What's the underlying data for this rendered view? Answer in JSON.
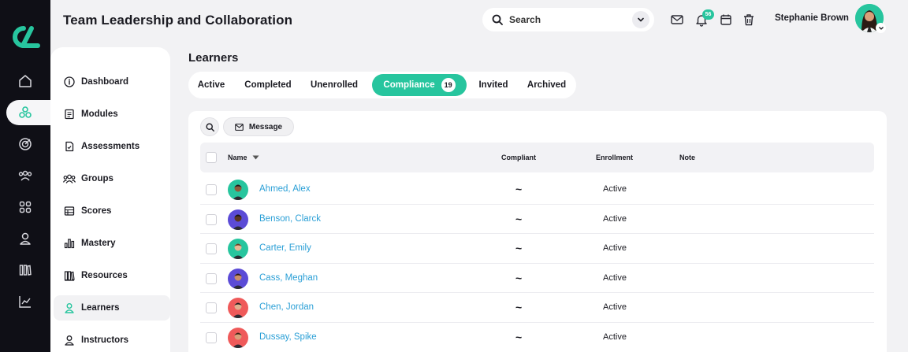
{
  "header": {
    "title": "Team Leadership and Collaboration",
    "search_placeholder": "Search",
    "notification_count": "56",
    "user_name": "Stephanie Brown"
  },
  "rail": {
    "items": [
      {
        "icon": "home-icon",
        "active": false
      },
      {
        "icon": "share-nodes-icon",
        "active": true
      },
      {
        "icon": "target-icon",
        "active": false
      },
      {
        "icon": "users-icon",
        "active": false
      },
      {
        "icon": "grid-icon",
        "active": false
      },
      {
        "icon": "user-icon",
        "active": false
      },
      {
        "icon": "library-icon",
        "active": false
      },
      {
        "icon": "chart-line-icon",
        "active": false
      }
    ]
  },
  "subnav": {
    "items": [
      {
        "label": "Dashboard",
        "icon": "info-icon"
      },
      {
        "label": "Modules",
        "icon": "document-icon"
      },
      {
        "label": "Assessments",
        "icon": "assessment-icon"
      },
      {
        "label": "Groups",
        "icon": "group-icon"
      },
      {
        "label": "Scores",
        "icon": "table-icon"
      },
      {
        "label": "Mastery",
        "icon": "bar-chart-icon"
      },
      {
        "label": "Resources",
        "icon": "books-icon"
      },
      {
        "label": "Learners",
        "icon": "learner-icon",
        "active": true
      },
      {
        "label": "Instructors",
        "icon": "instructor-icon"
      }
    ]
  },
  "main": {
    "section_title": "Learners",
    "tabs": [
      {
        "label": "Active"
      },
      {
        "label": "Completed"
      },
      {
        "label": "Unenrolled"
      },
      {
        "label": "Compliance",
        "count": "19",
        "active": true
      },
      {
        "label": "Invited"
      },
      {
        "label": "Archived"
      }
    ],
    "toolbar": {
      "message_label": "Message"
    },
    "columns": {
      "name": "Name",
      "compliant": "Compliant",
      "enrollment": "Enrollment",
      "note": "Note"
    },
    "rows": [
      {
        "name": "Ahmed, Alex",
        "compliant": "~",
        "enrollment": "Active",
        "avatar_bg": "#27c59e",
        "skin": "#8d5a3b",
        "hair": "#1a1a1a"
      },
      {
        "name": "Benson, Clarck",
        "compliant": "~",
        "enrollment": "Active",
        "avatar_bg": "#5b4bd6",
        "skin": "#5a3522",
        "hair": "#141414"
      },
      {
        "name": "Carter, Emily",
        "compliant": "~",
        "enrollment": "Active",
        "avatar_bg": "#27c59e",
        "skin": "#e8b896",
        "hair": "#6b3f22"
      },
      {
        "name": "Cass, Meghan",
        "compliant": "~",
        "enrollment": "Active",
        "avatar_bg": "#5b4bd6",
        "skin": "#c98e6a",
        "hair": "#2a1a12"
      },
      {
        "name": "Chen, Jordan",
        "compliant": "~",
        "enrollment": "Active",
        "avatar_bg": "#ef5a5a",
        "skin": "#e0b08e",
        "hair": "#1a1a1a"
      },
      {
        "name": "Dussay, Spike",
        "compliant": "~",
        "enrollment": "Active",
        "avatar_bg": "#ef5a5a",
        "skin": "#d9a07a",
        "hair": "#3a2414"
      }
    ]
  },
  "colors": {
    "accent": "#27c59e",
    "rail_bg": "#0f0f16",
    "link": "#2a9fd6"
  }
}
